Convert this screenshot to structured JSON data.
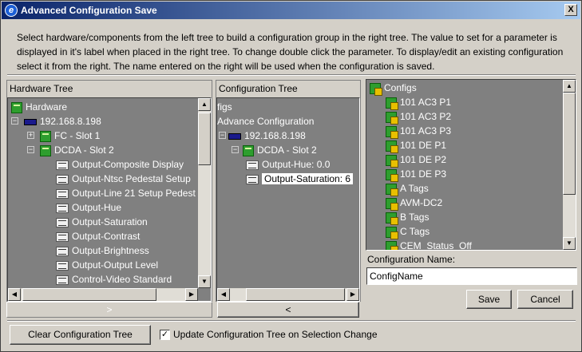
{
  "window": {
    "title": "Advanced Configuration Save",
    "close_label": "X"
  },
  "instructions": "Select hardware/components from the left tree to build a configuration group in the right tree.  The value to set for a parameter is displayed in it's label when placed in the right tree.  To change double click the parameter.  To display/edit an existing configuration select it from the right.  The name entered on the right will be used when the configuration is saved.",
  "hardware_tree": {
    "header": "Hardware Tree",
    "items": [
      "Hardware",
      "192.168.8.198",
      "FC - Slot 1",
      "DCDA - Slot 2",
      "Output-Composite Display",
      "Output-Ntsc Pedestal Setup",
      "Output-Line 21 Setup Pedest",
      "Output-Hue",
      "Output-Saturation",
      "Output-Contrast",
      "Output-Brightness",
      "Output-Output Level",
      "Control-Video Standard"
    ],
    "button_label": ">"
  },
  "config_tree": {
    "header": "Configuration Tree",
    "items": [
      "figs",
      "Advance Configuration",
      "192.168.8.198",
      "DCDA - Slot 2",
      "Output-Hue: 0.0",
      "Output-Saturation: 6"
    ],
    "button_label": "<"
  },
  "configs": {
    "items": [
      "Configs",
      "101 AC3 P1",
      "101 AC3 P2",
      "101 AC3 P3",
      "101 DE P1",
      "101 DE P2",
      "101 DE P3",
      "A Tags",
      "AVM-DC2",
      "B Tags",
      "C Tags",
      "CEM_Status_Off"
    ]
  },
  "config_name": {
    "label": "Configuration Name:",
    "value": "ConfigName"
  },
  "buttons": {
    "save": "Save",
    "cancel": "Cancel",
    "clear": "Clear Configuration Tree"
  },
  "update_checkbox": {
    "label": "Update Configuration Tree on Selection Change",
    "checked": true
  }
}
